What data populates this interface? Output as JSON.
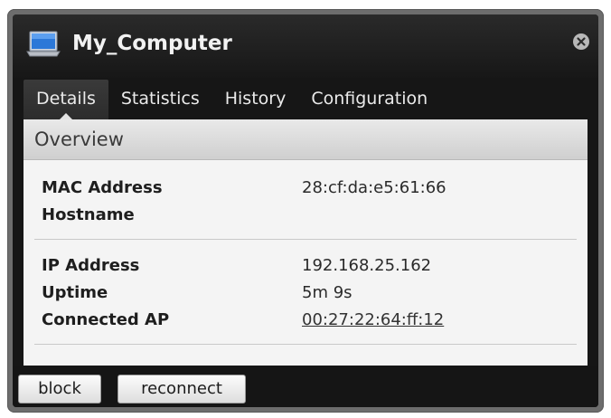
{
  "window": {
    "title": "My_Computer",
    "icon": "laptop-icon",
    "close_icon": "close-icon"
  },
  "tabs": [
    {
      "label": "Details",
      "active": true
    },
    {
      "label": "Statistics",
      "active": false
    },
    {
      "label": "History",
      "active": false
    },
    {
      "label": "Configuration",
      "active": false
    }
  ],
  "overview": {
    "header": "Overview",
    "group1": [
      {
        "label": "MAC Address",
        "value": "28:cf:da:e5:61:66"
      },
      {
        "label": "Hostname",
        "value": ""
      }
    ],
    "group2": [
      {
        "label": "IP Address",
        "value": "192.168.25.162"
      },
      {
        "label": "Uptime",
        "value": "5m 9s"
      },
      {
        "label": "Connected AP",
        "value": "00:27:22:64:ff:12",
        "link": true
      }
    ]
  },
  "actions": {
    "block_label": "block",
    "reconnect_label": "reconnect"
  },
  "colors": {
    "window_bg": "#161616",
    "content_bg": "#f4f4f4",
    "frame": "#6d6d6d"
  }
}
